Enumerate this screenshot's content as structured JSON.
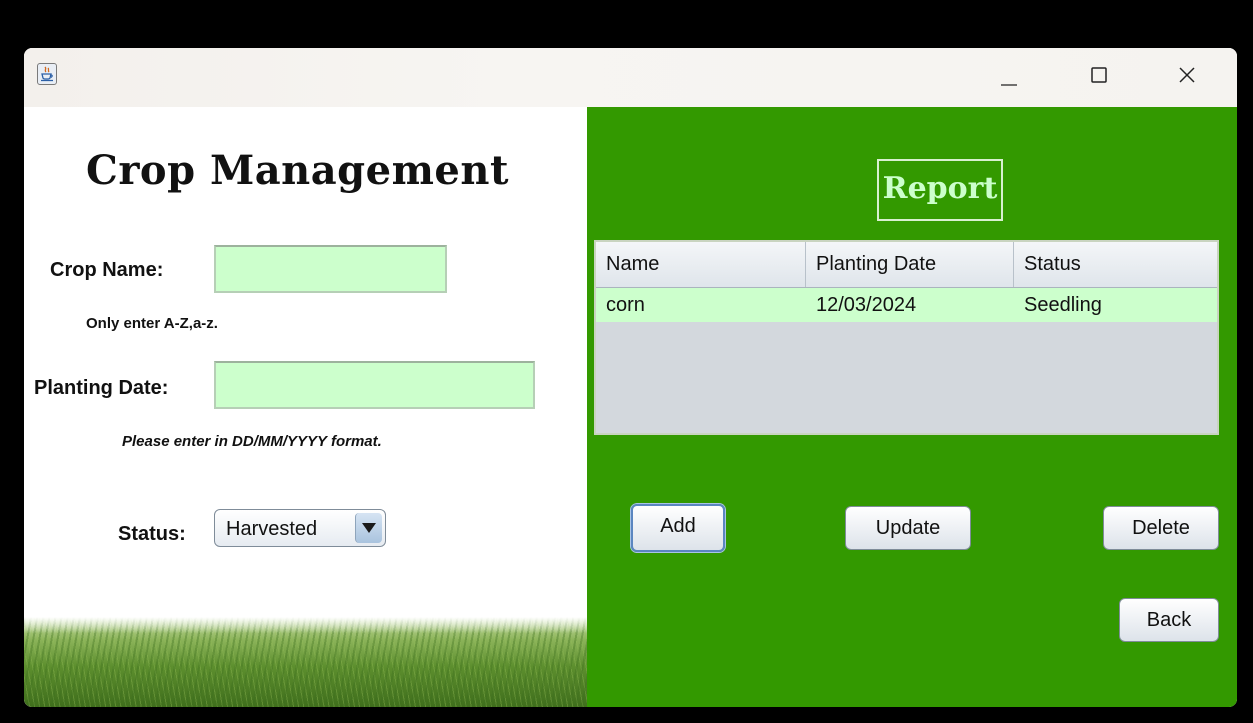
{
  "window": {
    "app_icon": "java-coffee-cup-icon",
    "controls": [
      "minimize-icon",
      "maximize-icon",
      "close-icon"
    ]
  },
  "form": {
    "title": "Crop Management",
    "crop_name": {
      "label": "Crop Name:",
      "value": "",
      "hint": "Only enter A-Z,a-z."
    },
    "planting_date": {
      "label": "Planting Date:",
      "value": "",
      "hint": "Please enter in DD/MM/YYYY  format."
    },
    "status": {
      "label": "Status:",
      "selected": "Harvested"
    }
  },
  "report": {
    "title": "Report",
    "columns": [
      "Name",
      "Planting Date",
      "Status"
    ],
    "rows": [
      [
        "corn",
        "12/03/2024",
        "Seedling"
      ]
    ]
  },
  "buttons": {
    "add": "Add",
    "update": "Update",
    "delete": "Delete",
    "back": "Back"
  },
  "colors": {
    "panel_green": "#339900",
    "field_green": "#ccffcc",
    "report_text": "#ccffcc"
  }
}
